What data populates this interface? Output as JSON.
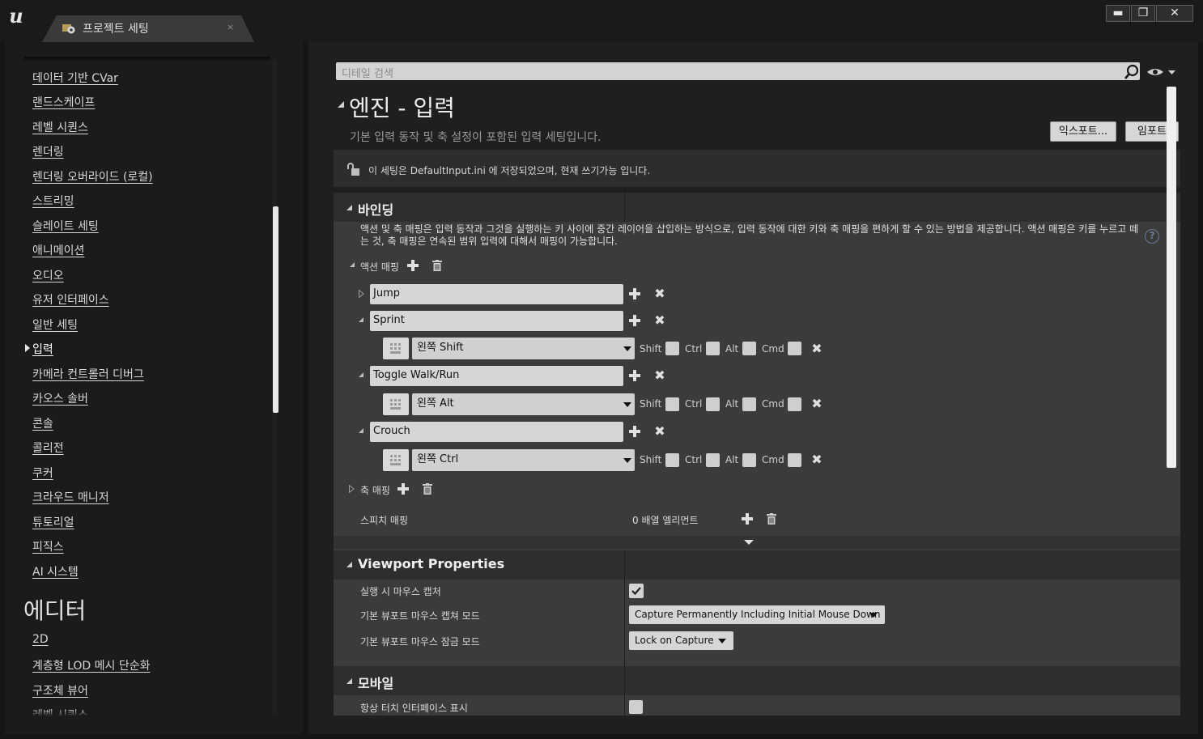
{
  "window": {
    "tab_title": "프로젝트 세팅",
    "tab_close": "×",
    "minimize": "▬",
    "maximize": "❐",
    "close": "✕"
  },
  "sidebar": {
    "items": [
      {
        "label": "데이터 기반 CVar"
      },
      {
        "label": "랜드스케이프"
      },
      {
        "label": "레벨 시퀀스"
      },
      {
        "label": "렌더링"
      },
      {
        "label": "렌더링 오버라이드 (로컬)"
      },
      {
        "label": "스트리밍"
      },
      {
        "label": "슬레이트 세팅"
      },
      {
        "label": "애니메이션"
      },
      {
        "label": "오디오"
      },
      {
        "label": "유저 인터페이스"
      },
      {
        "label": "일반 세팅"
      },
      {
        "label": "입력",
        "active": true
      },
      {
        "label": "카메라 컨트롤러 디버그"
      },
      {
        "label": "카오스 솔버"
      },
      {
        "label": "콘솔"
      },
      {
        "label": "콜리전"
      },
      {
        "label": "쿠커"
      },
      {
        "label": "크라우드 매니저"
      },
      {
        "label": "튜토리얼"
      },
      {
        "label": "피직스"
      },
      {
        "label": "AI 시스템"
      }
    ],
    "editor_heading": "에디터",
    "editor_items": [
      {
        "label": "2D"
      },
      {
        "label": "계층형 LOD 메시 단순화"
      },
      {
        "label": "구조체 뷰어"
      },
      {
        "label": "레벨 시퀀스"
      }
    ]
  },
  "search": {
    "placeholder": "디테일 검색"
  },
  "header": {
    "title": "엔진 - 입력",
    "description": "기본 입력 동작 및 축 설정이 포함된 입력 세팅입니다.",
    "export_label": "익스포트...",
    "import_label": "임포트"
  },
  "notice": {
    "text": "이 세팅은 DefaultInput.ini 에 저장되었으며, 현재 쓰기가능 입니다."
  },
  "bindings": {
    "title": "바인딩",
    "description": "액션 및 축 매핑은 입력 동작과 그것을 실행하는 키 사이에 중간 레이어을 삽입하는 방식으로, 입력 동작에 대한 키와 축 매핑을 편하게 할 수 있는 방법을 제공합니다. 액션 매핑은 키를 누르고 떼는 것, 축 매핑은 연속된 범위 입력에 대해서 매핑이 가능합니다.",
    "help_glyph": "?",
    "action_mappings_label": "액션 매핑",
    "actions": [
      {
        "name": "Jump",
        "expanded": false
      },
      {
        "name": "Sprint",
        "expanded": true,
        "key": "왼쪽 Shift"
      },
      {
        "name": "Toggle Walk/Run",
        "expanded": true,
        "key": "왼쪽 Alt"
      },
      {
        "name": "Crouch",
        "expanded": true,
        "key": "왼쪽 Ctrl"
      }
    ],
    "modifiers": {
      "shift": "Shift",
      "ctrl": "Ctrl",
      "alt": "Alt",
      "cmd": "Cmd"
    },
    "axis_mappings_label": "축 매핑",
    "speech_mappings_label": "스피치 매핑",
    "speech_mappings_value": "0 배열 엘리먼트"
  },
  "viewport": {
    "title": "Viewport Properties",
    "capture_on_play_label": "실행 시 마우스 캡처",
    "capture_on_play": true,
    "capture_mode_label": "기본 뷰포트 마우스 캡쳐 모드",
    "capture_mode_value": "Capture Permanently Including Initial Mouse Down",
    "lock_mode_label": "기본 뷰포트 마우스 잠금 모드",
    "lock_mode_value": "Lock on Capture"
  },
  "mobile": {
    "title": "모바일",
    "always_show_touch_label": "항상 터치 인터페이스 표시",
    "always_show_touch": false
  }
}
